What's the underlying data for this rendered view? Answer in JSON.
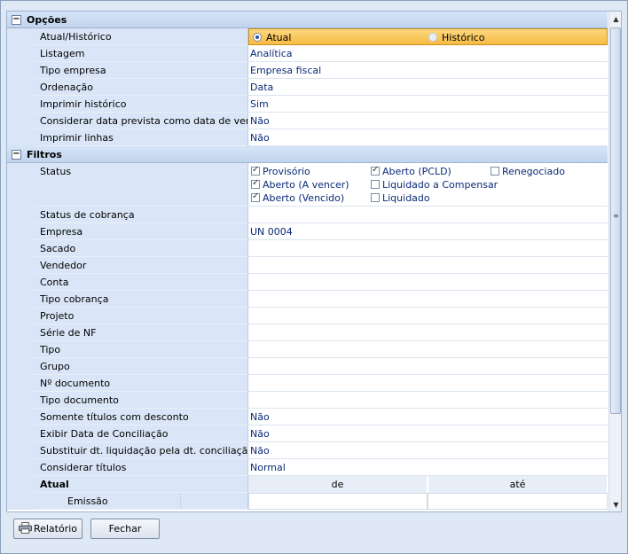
{
  "sections": {
    "opcoes": {
      "title": "Opções",
      "toggle": "−"
    },
    "filtros": {
      "title": "Filtros",
      "toggle": "−"
    }
  },
  "opcoes_rows": [
    {
      "label": "Atual/Histórico",
      "value": ""
    },
    {
      "label": "Listagem",
      "value": "Analítica"
    },
    {
      "label": "Tipo empresa",
      "value": "Empresa fiscal"
    },
    {
      "label": "Ordenação",
      "value": "Data"
    },
    {
      "label": "Imprimir histórico",
      "value": "Sim"
    },
    {
      "label": "Considerar data prevista como data de vencimento",
      "value": "Não"
    },
    {
      "label": "Imprimir linhas",
      "value": "Não"
    }
  ],
  "atual_historico": {
    "option1": "Atual",
    "option2": "Histórico",
    "selected": "Atual"
  },
  "status": {
    "label": "Status",
    "options": [
      {
        "label": "Provisório",
        "checked": true
      },
      {
        "label": "Aberto (PCLD)",
        "checked": true
      },
      {
        "label": "Renegociado",
        "checked": false
      },
      {
        "label": "Aberto (A vencer)",
        "checked": true
      },
      {
        "label": "Liquidado a Compensar",
        "checked": false
      },
      {
        "label": "Aberto (Vencido)",
        "checked": true
      },
      {
        "label": "Liquidado",
        "checked": false
      }
    ]
  },
  "filtros_rows": [
    {
      "label": "Status de cobrança",
      "value": ""
    },
    {
      "label": "Empresa",
      "value": "UN 0004"
    },
    {
      "label": "Sacado",
      "value": ""
    },
    {
      "label": "Vendedor",
      "value": ""
    },
    {
      "label": "Conta",
      "value": ""
    },
    {
      "label": "Tipo cobrança",
      "value": ""
    },
    {
      "label": "Projeto",
      "value": ""
    },
    {
      "label": "Série de NF",
      "value": ""
    },
    {
      "label": "Tipo",
      "value": ""
    },
    {
      "label": "Grupo",
      "value": ""
    },
    {
      "label": "Nº documento",
      "value": ""
    },
    {
      "label": "Tipo documento",
      "value": ""
    },
    {
      "label": "Somente títulos com desconto",
      "value": "Não"
    },
    {
      "label": "Exibir Data de Conciliação",
      "value": "Não"
    },
    {
      "label": "Substituir dt. liquidação pela dt. conciliação",
      "value": "Não"
    },
    {
      "label": "Considerar títulos",
      "value": "Normal"
    }
  ],
  "atual_table": {
    "label": "Atual",
    "col_from": "de",
    "col_to": "até",
    "row_label": "Emissão"
  },
  "buttons": {
    "report": "Relatório",
    "close": "Fechar"
  }
}
